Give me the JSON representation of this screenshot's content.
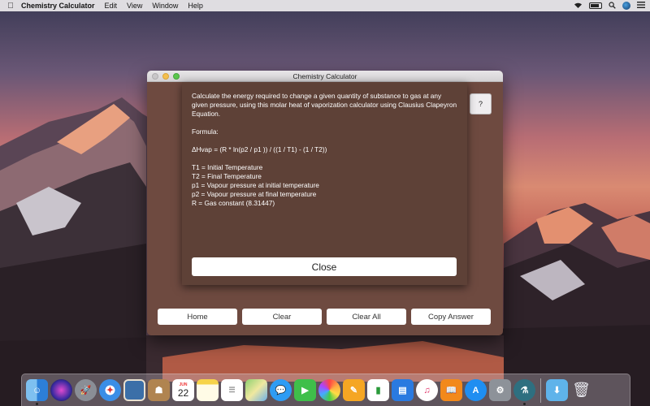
{
  "menubar": {
    "app_name": "Chemistry Calculator",
    "items": [
      "Edit",
      "View",
      "Window",
      "Help"
    ]
  },
  "window": {
    "title": "Chemistry Calculator",
    "help_label": "?",
    "sheet": {
      "description": "Calculate the energy required to change a given quantity of substance to gas at any given pressure, using this molar heat of vaporization calculator using Clausius Clapeyron Equation.",
      "formula_heading": "Formula:",
      "formula": "ΔHvap = (R * ln(p2 / p1 )) / ((1 / T1) - (1 / T2))",
      "variables": [
        "T1 = Initial Temperature",
        "T2 = Final Temperature",
        "p1 = Vapour pressure at initial temperature",
        "p2 = Vapour pressure at final temperature",
        "R = Gas constant (8.31447)"
      ],
      "close_label": "Close"
    },
    "buttons": {
      "home": "Home",
      "clear": "Clear",
      "clear_all": "Clear All",
      "copy_answer": "Copy Answer"
    }
  },
  "dock": {
    "calendar_month": "JUN",
    "calendar_day": "22",
    "icons": [
      "finder-icon",
      "siri-icon",
      "launchpad-icon",
      "safari-icon",
      "photo-preview-icon",
      "contacts-icon",
      "calendar-icon",
      "notes-icon",
      "reminders-icon",
      "maps-icon",
      "messages-icon",
      "facetime-icon",
      "photos-icon",
      "pages-icon",
      "numbers-icon",
      "keynote-icon",
      "itunes-icon",
      "ibooks-icon",
      "app-store-icon",
      "system-preferences-icon",
      "chemistry-calculator-icon",
      "downloads-folder-icon",
      "trash-icon"
    ]
  },
  "colors": {
    "window_bg": "#6e4a40",
    "sheet_bg": "#5e4137"
  }
}
